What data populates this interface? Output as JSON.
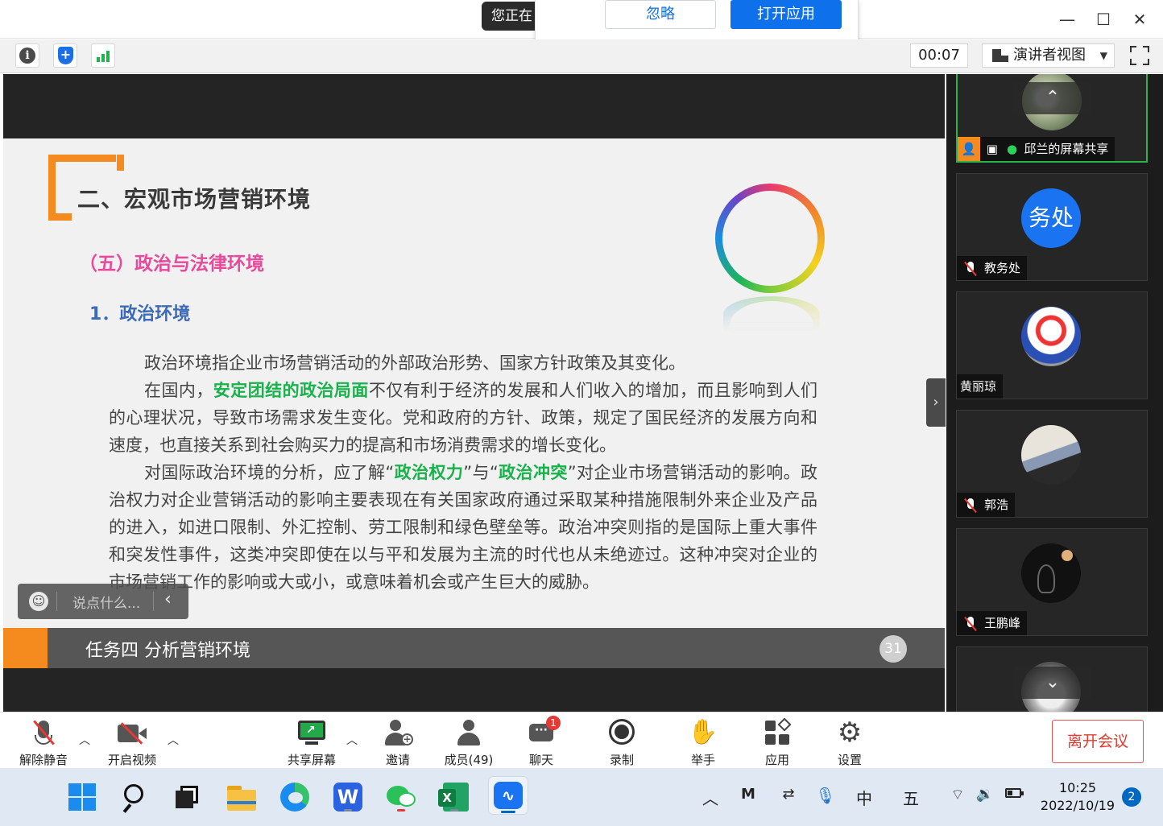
{
  "titlebar": {
    "share_notice": "您正在",
    "ignore_label": "忽略",
    "open_app_label": "打开应用",
    "minimize": "—",
    "maximize": "☐",
    "close": "✕"
  },
  "meeting_bar": {
    "timer": "00:07",
    "view_mode": "演讲者视图"
  },
  "slide": {
    "title": "二、宏观市场营销环境",
    "subtitle": "（五）政治与法律环境",
    "section": "1．政治环境",
    "p1": "政治环境指企业市场营销活动的外部政治形势、国家方针政策及其变化。",
    "p2_a": "在国内，",
    "p2_hl": "安定团结的政治局面",
    "p2_b": "不仅有利于经济的发展和人们收入的增加，而且影响到人们的心理状况，导致市场需求发生变化。党和政府的方针、政策，规定了国民经济的发展方向和速度，也直接关系到社会购买力的提高和市场消费需求的增长变化。",
    "p3_a": "对国际政治环境的分析，应了解“",
    "p3_hl1": "政治权力",
    "p3_b": "”与“",
    "p3_hl2": "政治冲突",
    "p3_c": "”对企业市场营销活动的影响。政治权力对企业营销活动的影响主要表现在有关国家政府通过采取某种措施限制外来企业及产品的进入，如进口限制、外汇控制、劳工限制和绿色壁垒等。政治冲突则指的是国际上重大事件和突发性事件，这类冲突即使在以与平和发展为主流的时代也从未绝迹过。这种冲突对企业的市场营销工作的影响或大或小，或意味着机会或产生巨大的威胁。",
    "footer": "任务四 分析营销环境",
    "page": "31"
  },
  "chat": {
    "placeholder": "说点什么..."
  },
  "participants": [
    {
      "name": "邱兰的屏幕共享",
      "muted": false
    },
    {
      "name": "教务处",
      "muted": true,
      "avatar_text": "务处"
    },
    {
      "name": "黄丽琼",
      "muted": false
    },
    {
      "name": "郭浩",
      "muted": true
    },
    {
      "name": "王鹏峰",
      "muted": true
    }
  ],
  "controls": {
    "unmute": "解除静音",
    "start_video": "开启视频",
    "share_screen": "共享屏幕",
    "invite": "邀请",
    "members": "成员(49)",
    "chat": "聊天",
    "chat_badge": "1",
    "record": "录制",
    "raise_hand": "举手",
    "apps": "应用",
    "settings": "设置",
    "leave": "离开会议"
  },
  "taskbar": {
    "ime_mode": "中",
    "ime_name": "五",
    "time": "10:25",
    "date": "2022/10/19",
    "notifications": "2"
  },
  "colors": {
    "accent_blue": "#0e71eb",
    "slide_orange": "#f58a1f",
    "highlight_green": "#17b24a",
    "subtitle_pink": "#e64a9a",
    "section_blue": "#3b6bb8",
    "leave_red": "#e0392f"
  }
}
